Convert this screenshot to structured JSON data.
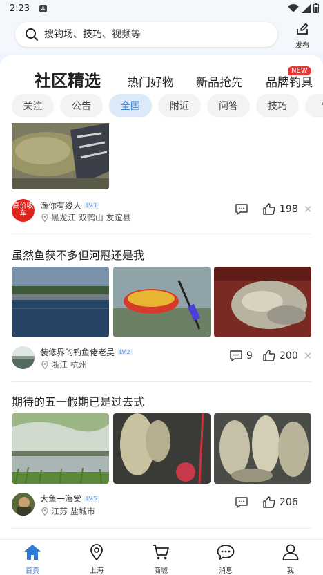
{
  "status": {
    "time": "2:23",
    "sim": "A"
  },
  "search": {
    "placeholder": "搜钓场、技巧、视频等"
  },
  "publish": {
    "label": "发布"
  },
  "tabs": [
    {
      "label": "社区精选",
      "active": true
    },
    {
      "label": "热门好物"
    },
    {
      "label": "新品抢先"
    },
    {
      "label": "品牌钓具",
      "badge": "NEW"
    }
  ],
  "chips": [
    "关注",
    "公告",
    "全国",
    "附近",
    "问答",
    "技巧",
    "饵"
  ],
  "chips_active": "全国",
  "posts": [
    {
      "author": "渔你有缘人",
      "level": "LV.1",
      "avatar_text": "高价收车",
      "location": "黑龙江 双鸭山 友谊县",
      "comments": "",
      "likes": "198"
    },
    {
      "title": "虽然鱼获不多但河冠还是我",
      "author": "装修界的钓鱼佬老吴",
      "level": "LV.2",
      "location": "浙江 杭州",
      "comments": "9",
      "likes": "200"
    },
    {
      "title": "期待的五一假期已是过去式",
      "author": "大鱼一海棠",
      "level": "LV.5",
      "location": "江苏 盐城市",
      "comments": "",
      "likes": "206"
    }
  ],
  "nav": [
    {
      "label": "首页",
      "icon": "home-icon",
      "active": true
    },
    {
      "label": "上海",
      "icon": "location-pin-icon"
    },
    {
      "label": "商城",
      "icon": "cart-icon"
    },
    {
      "label": "消息",
      "icon": "message-icon"
    },
    {
      "label": "我",
      "icon": "person-icon"
    }
  ],
  "colors": {
    "accent": "#2d7ad6",
    "badge": "#e53935",
    "chip_active_bg": "#dce9f8"
  }
}
